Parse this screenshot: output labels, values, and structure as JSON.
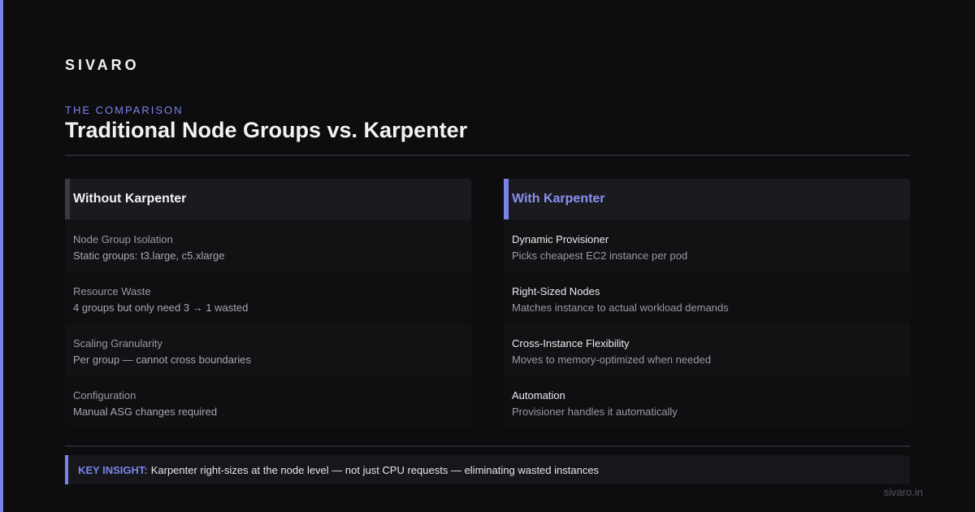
{
  "brand": "SIVARO",
  "eyebrow": "THE COMPARISON",
  "title": "Traditional Node Groups vs. Karpenter",
  "colors": {
    "accent": "#7b83eb",
    "background": "#0d0d0f"
  },
  "left_column": {
    "heading": "Without Karpenter",
    "rows": [
      {
        "label": "Node Group Isolation",
        "value": "Static groups: t3.large, c5.xlarge"
      },
      {
        "label": "Resource Waste",
        "value": "4 groups but only need 3 → 1 wasted"
      },
      {
        "label": "Scaling Granularity",
        "value": "Per group — cannot cross boundaries"
      },
      {
        "label": "Configuration",
        "value": "Manual ASG changes required"
      }
    ]
  },
  "right_column": {
    "heading": "With Karpenter",
    "rows": [
      {
        "label": "Dynamic Provisioner",
        "value": "Picks cheapest EC2 instance per pod"
      },
      {
        "label": "Right-Sized Nodes",
        "value": "Matches instance to actual workload demands"
      },
      {
        "label": "Cross-Instance Flexibility",
        "value": "Moves to memory-optimized when needed"
      },
      {
        "label": "Automation",
        "value": "Provisioner handles it automatically"
      }
    ]
  },
  "insight": {
    "label": "KEY INSIGHT:",
    "text": "Karpenter right-sizes at the node level — not just CPU requests — eliminating wasted instances"
  },
  "footer_url": "sivaro.in"
}
